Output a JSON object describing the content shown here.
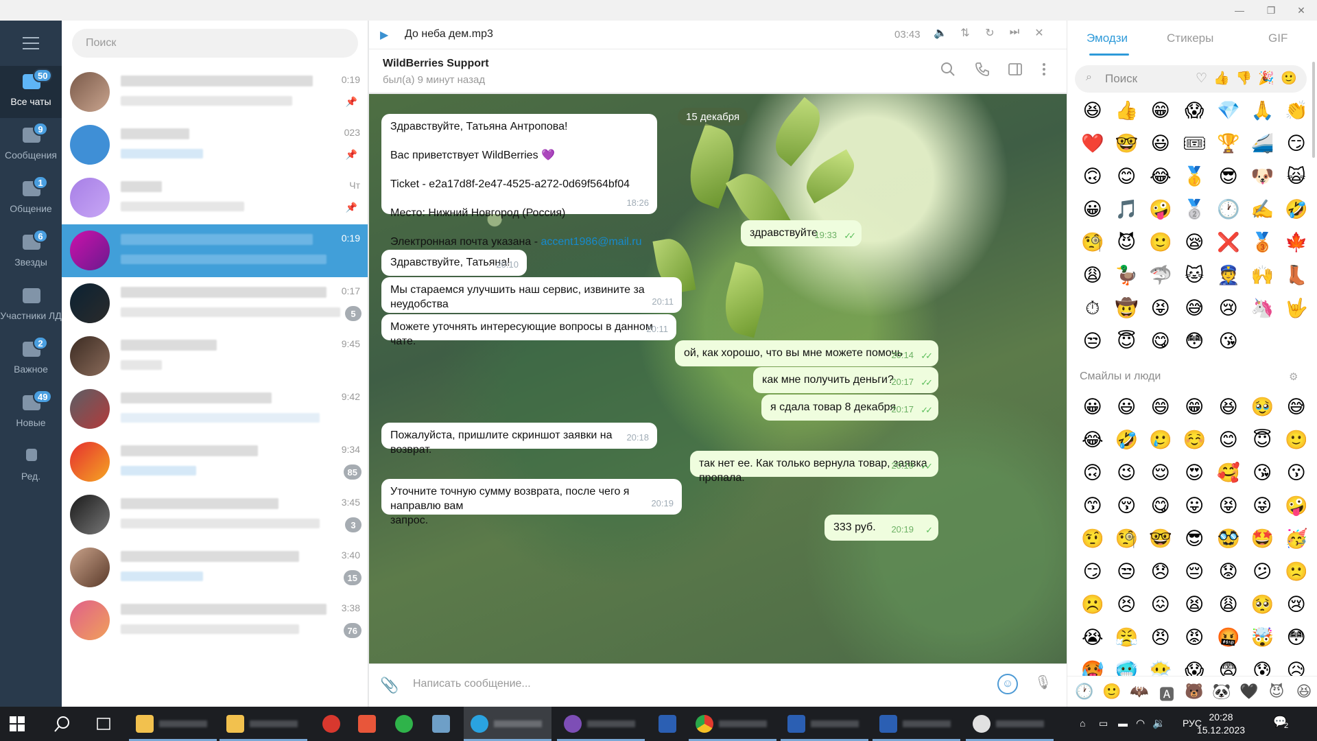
{
  "window": {
    "controls": [
      "—",
      "❐",
      "✕"
    ]
  },
  "folders": {
    "menu_icon": "hamburger-icon",
    "items": [
      {
        "label": "Все чаты",
        "badge": "50",
        "active": true
      },
      {
        "label": "Сообщения",
        "badge": "9"
      },
      {
        "label": "Общение",
        "badge": "1"
      },
      {
        "label": "Звезды",
        "badge": "6"
      },
      {
        "label": "Участники ЛД",
        "badge": ""
      },
      {
        "label": "Важное",
        "badge": "2"
      },
      {
        "label": "Новые",
        "badge": "49"
      },
      {
        "label": "Ред.",
        "badge": ""
      }
    ]
  },
  "chatlist": {
    "search_placeholder": "Поиск",
    "rows": [
      {
        "time": "0:19",
        "badge": "",
        "pinned": true
      },
      {
        "time": "023",
        "badge": "",
        "pinned": true
      },
      {
        "time": "Чт",
        "badge": "",
        "pinned": true
      },
      {
        "time": "0:19",
        "badge": "",
        "active": true
      },
      {
        "time": "0:17",
        "badge": "5"
      },
      {
        "time": "9:45",
        "badge": ""
      },
      {
        "time": "9:42",
        "badge": ""
      },
      {
        "time": "9:34",
        "badge": "85"
      },
      {
        "time": "3:45",
        "badge": "3"
      },
      {
        "time": "3:40",
        "badge": "15"
      },
      {
        "time": "3:38",
        "badge": "76"
      }
    ]
  },
  "player": {
    "track": "До неба дем.mp3",
    "time": "03:43"
  },
  "header": {
    "peer": "WildBerries Support",
    "status": "был(а) 9 минут назад"
  },
  "date_label": "15 декабря",
  "messages": [
    {
      "dir": "in",
      "text": "Здравствуйте, Татьяна Антропова!\n\nВас приветствует WildBerries 💜\n\nTicket - e2a17d8f-2e47-4525-a272-0d69f564bf04\n\nМесто: Нижний Новгород (Россия)\n\nЭлектронная почта указана - ",
      "link": "accent1986@mail.ru",
      "time": "18:26"
    },
    {
      "dir": "out",
      "text": "здравствуйте",
      "time": "19:33"
    },
    {
      "dir": "in",
      "text": "Здравствуйте, Татьяна!",
      "time": "20:10"
    },
    {
      "dir": "in",
      "text": "Мы стараемся улучшить наш сервис, извините за неудобства\nкоторые возникли.",
      "time": "20:11"
    },
    {
      "dir": "in",
      "text": "Можете уточнять интересующие вопросы в данном чате.",
      "time": "20:11"
    },
    {
      "dir": "out",
      "text": "ой, как хорошо, что вы мне можете помочь",
      "time": "20:14"
    },
    {
      "dir": "out",
      "text": "как мне получить деньги?",
      "time": "20:17"
    },
    {
      "dir": "out",
      "text": "я сдала товар 8 декабря",
      "time": "20:17"
    },
    {
      "dir": "in",
      "text": "Пожалуйста, пришлите скриншот заявки на возврат.",
      "time": "20:18"
    },
    {
      "dir": "out",
      "text": "так нет ее. Как только вернула товар, заявка пропала.",
      "time": "20:19"
    },
    {
      "dir": "in",
      "text": "Уточните точную сумму возврата, после чего я направлю вам\nзапрос.",
      "time": "20:19"
    },
    {
      "dir": "out",
      "text": "333 руб.",
      "time": "20:19"
    }
  ],
  "composer": {
    "placeholder": "Написать сообщение..."
  },
  "emoji_panel": {
    "tabs": [
      "Эмодзи",
      "Стикеры",
      "GIF"
    ],
    "search_placeholder": "Поиск",
    "category_icons": "♡👍👎🎉🙂",
    "recent": [
      "😆",
      "👍",
      "😁",
      "😱",
      "💎",
      "🙏",
      "👏",
      "❤️",
      "🤓",
      "😃",
      "🎟",
      "🏆",
      "🚄",
      "😏",
      "🙃",
      "😊",
      "😂",
      "🥇",
      "😎",
      "🐶",
      "🙀",
      "😀",
      "🎵",
      "🤪",
      "🥈",
      "🕐",
      "✍️",
      "🤣",
      "🧐",
      "😈",
      "🙂",
      "😪",
      "❌",
      "🥉",
      "🍁",
      "😩",
      "🦆",
      "🦈",
      "🐱",
      "👮",
      "🙌",
      "👢",
      "⏱",
      "🤠",
      "😝",
      "😅",
      "😢",
      "🦄",
      "🤟",
      "😒",
      "😇",
      "😋",
      "😳",
      "😘"
    ],
    "section_title": "Смайлы и люди",
    "people": [
      "😀",
      "😃",
      "😄",
      "😁",
      "😆",
      "🥹",
      "😅",
      "😂",
      "🤣",
      "🥲",
      "☺️",
      "😊",
      "😇",
      "🙂",
      "🙃",
      "😉",
      "😌",
      "😍",
      "🥰",
      "😘",
      "😗",
      "😙",
      "😚",
      "😋",
      "😛",
      "😝",
      "😜",
      "🤪",
      "🤨",
      "🧐",
      "🤓",
      "😎",
      "🥸",
      "🤩",
      "🥳",
      "😏",
      "😒",
      "😞",
      "😔",
      "😟",
      "😕",
      "🙁",
      "☹️",
      "😣",
      "😖",
      "😫",
      "😩",
      "🥺",
      "😢",
      "😭",
      "😤",
      "😠",
      "😡",
      "🤬",
      "🤯",
      "😳",
      "🥵",
      "🥶",
      "😶‍🌫️",
      "😱",
      "😨",
      "😰",
      "😥"
    ],
    "bottom_icons": [
      "🕐",
      "🙂",
      "🦇",
      "🅰",
      "🐻",
      "🐼",
      "🖤",
      "😈",
      "😆"
    ]
  },
  "taskbar": {
    "clock_time": "20:28",
    "clock_date": "15.12.2023",
    "lang": "РУС",
    "notifications": "2"
  }
}
